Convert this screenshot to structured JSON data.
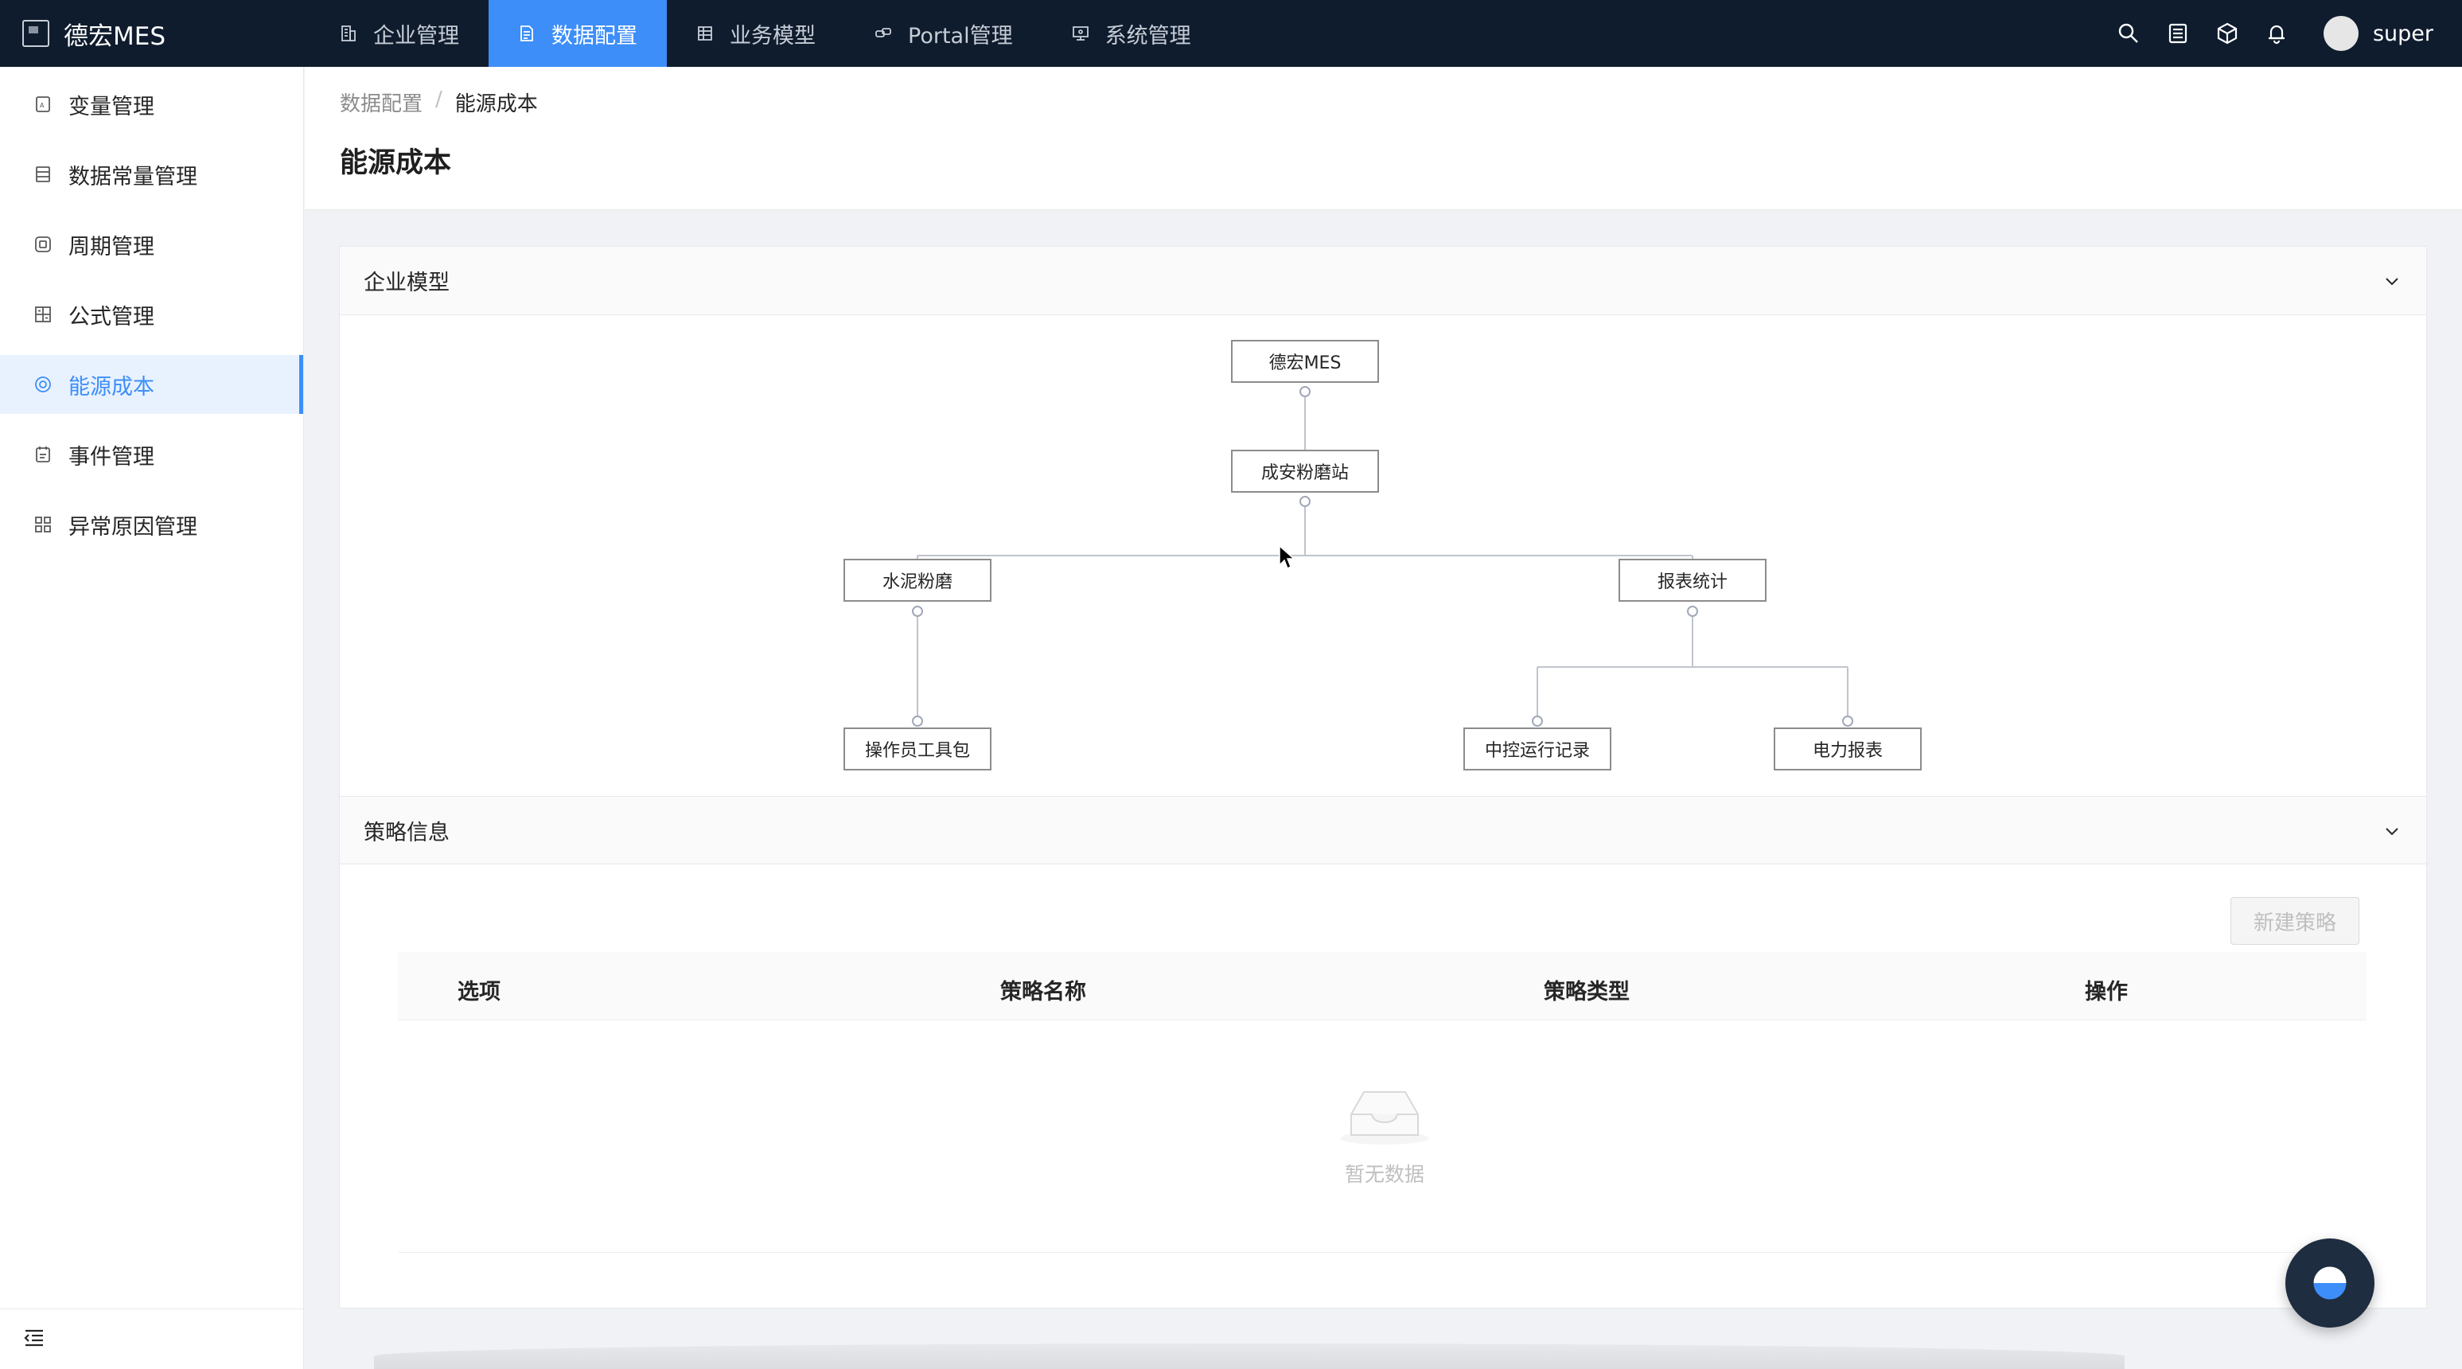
{
  "app": {
    "name": "德宏MES"
  },
  "topnav": {
    "items": [
      {
        "label": "企业管理",
        "icon": "building-icon",
        "active": false
      },
      {
        "label": "数据配置",
        "icon": "document-icon",
        "active": true
      },
      {
        "label": "业务模型",
        "icon": "table-icon",
        "active": false
      },
      {
        "label": "Portal管理",
        "icon": "link-icon",
        "active": false
      },
      {
        "label": "系统管理",
        "icon": "monitor-icon",
        "active": false
      }
    ],
    "right_icons": [
      "search-icon",
      "list-icon",
      "cube-icon",
      "bell-icon"
    ],
    "user": "super"
  },
  "sidebar": {
    "items": [
      {
        "label": "变量管理",
        "icon": "variable-icon",
        "active": false
      },
      {
        "label": "数据常量管理",
        "icon": "list-icon",
        "active": false
      },
      {
        "label": "周期管理",
        "icon": "cycle-icon",
        "active": false
      },
      {
        "label": "公式管理",
        "icon": "formula-icon",
        "active": false
      },
      {
        "label": "能源成本",
        "icon": "energy-icon",
        "active": true
      },
      {
        "label": "事件管理",
        "icon": "event-icon",
        "active": false
      },
      {
        "label": "异常原因管理",
        "icon": "grid-icon",
        "active": false
      }
    ],
    "collapse_icon": "menu-collapse-icon"
  },
  "breadcrumb": {
    "parent": "数据配置",
    "separator": "/",
    "current": "能源成本"
  },
  "page": {
    "title": "能源成本"
  },
  "enterprise_model": {
    "title": "企业模型",
    "nodes": {
      "root": "德宏MES",
      "station": "成安粉磨站",
      "cement": "水泥粉磨",
      "report": "报表统计",
      "toolkit": "操作员工具包",
      "control_record": "中控运行记录",
      "power_report": "电力报表"
    }
  },
  "strategy": {
    "title": "策略信息",
    "new_button": "新建策略",
    "columns": [
      "选项",
      "策略名称",
      "策略类型",
      "操作"
    ],
    "empty_text": "暂无数据"
  },
  "colors": {
    "accent": "#3d8ef8",
    "topbar": "#0f1c2e"
  }
}
